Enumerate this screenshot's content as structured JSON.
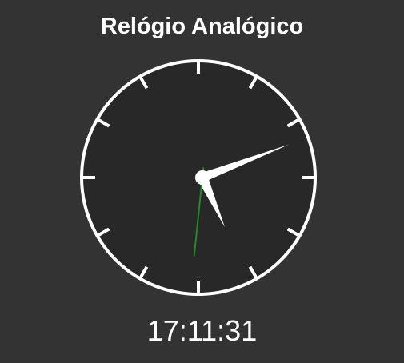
{
  "app": {
    "title": "Relógio Analógico"
  },
  "clock": {
    "time": "17:11:31",
    "hours": 17,
    "minutes": 11,
    "seconds": 31,
    "tick_marks": 12
  },
  "colors": {
    "background": "#333333",
    "face": "#282828",
    "foreground": "#ffffff",
    "second_hand": "#228B22"
  },
  "icons": {
    "clock": "analog-clock-icon"
  }
}
